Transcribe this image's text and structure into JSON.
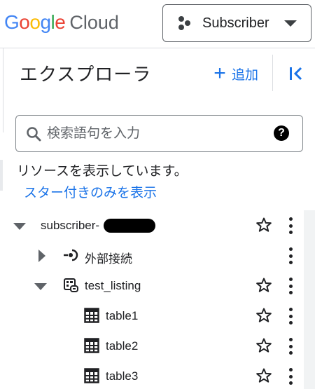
{
  "header": {
    "logo_letters": [
      {
        "ch": "G",
        "color": "#4285f4"
      },
      {
        "ch": "o",
        "color": "#ea4335"
      },
      {
        "ch": "o",
        "color": "#fbbc04"
      },
      {
        "ch": "g",
        "color": "#4285f4"
      },
      {
        "ch": "l",
        "color": "#34a853"
      },
      {
        "ch": "e",
        "color": "#ea4335"
      }
    ],
    "logo_suffix": "Cloud",
    "project_label": "Subscriber",
    "project_icon": "project-dots-icon"
  },
  "explorer": {
    "title": "エクスプローラ",
    "add_label": "追加",
    "collapse_icon": "collapse-left-icon"
  },
  "search": {
    "placeholder": "検索語句を入力",
    "help_symbol": "?"
  },
  "notice_text": "リソースを表示しています。",
  "starred_link": "スター付きのみを表示",
  "tree": {
    "project": {
      "label": "subscriber-",
      "expanded": true
    },
    "external": {
      "label": "外部接続",
      "expanded": false
    },
    "dataset": {
      "label": "test_listing",
      "expanded": true
    },
    "tables": [
      {
        "label": "table1"
      },
      {
        "label": "table2"
      },
      {
        "label": "table3"
      }
    ]
  },
  "colors": {
    "accent": "#1a73e8",
    "text": "#202124",
    "icon_gray": "#5f6368"
  }
}
